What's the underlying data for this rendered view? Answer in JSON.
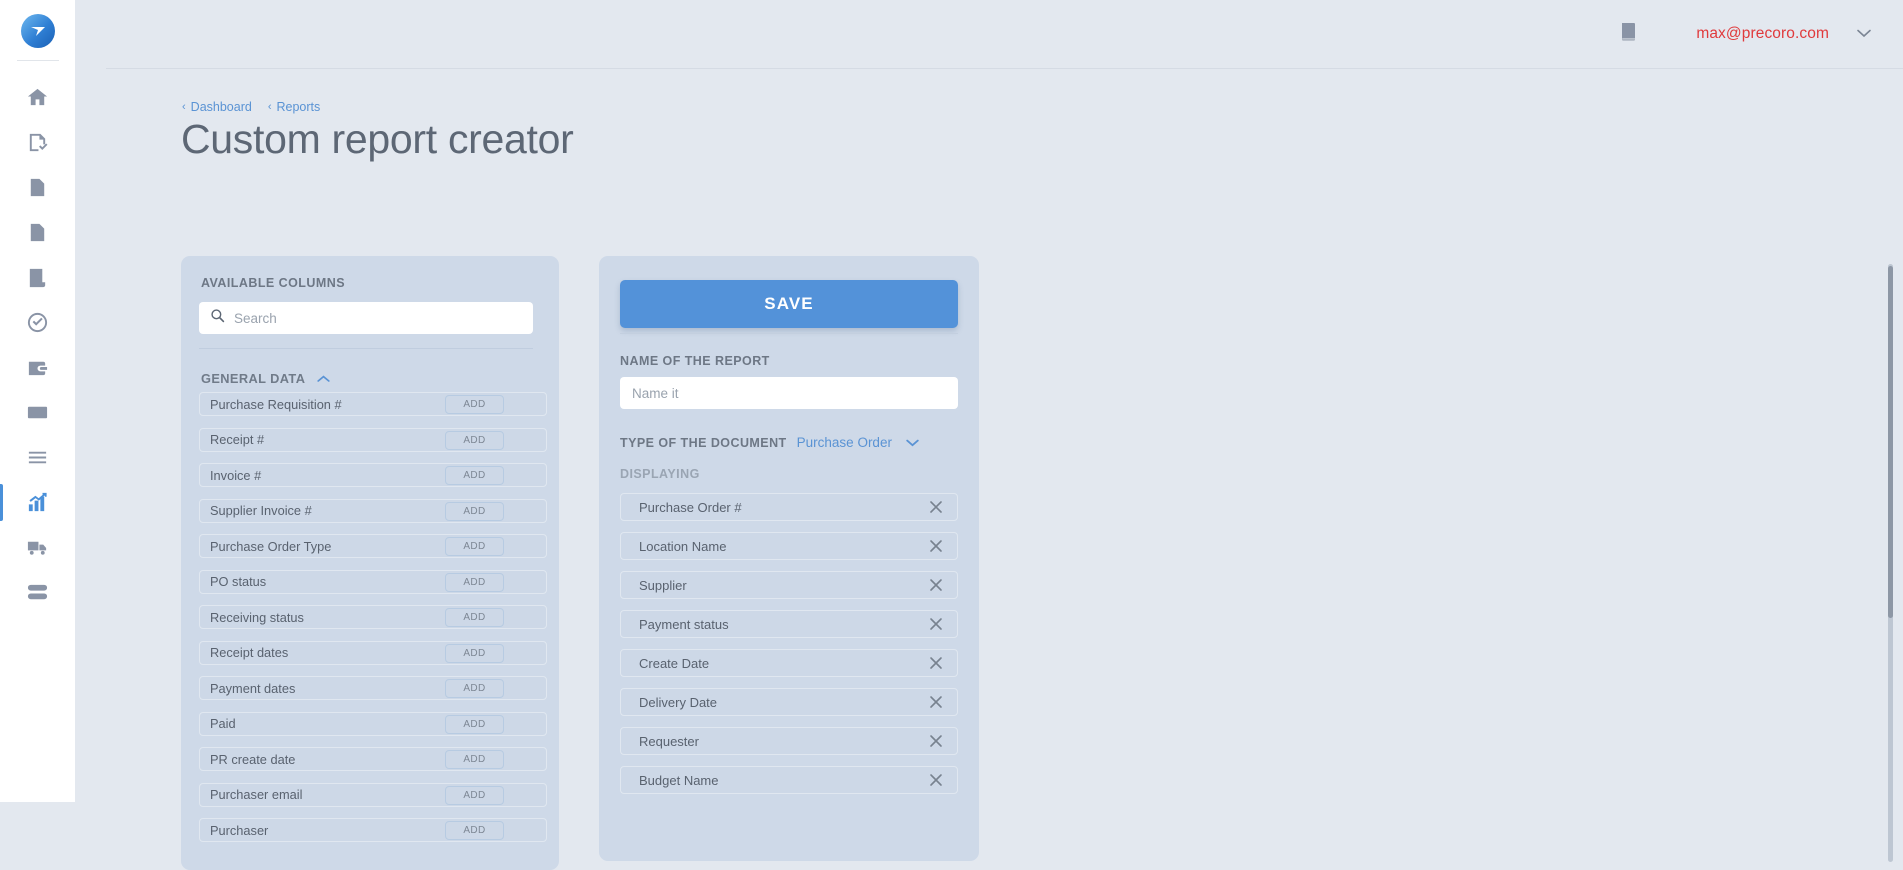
{
  "app": {
    "logo_name": "precoro-logo"
  },
  "nav": {
    "items": [
      {
        "name": "home",
        "icon": "home-icon",
        "active": false
      },
      {
        "name": "purchase-requisitions",
        "icon": "document-check-icon",
        "active": false
      },
      {
        "name": "purchase-orders",
        "icon": "document-lines-icon",
        "active": false
      },
      {
        "name": "invoices",
        "icon": "document-lines-alt-icon",
        "active": false
      },
      {
        "name": "receipts",
        "icon": "receipt-icon",
        "active": false
      },
      {
        "name": "approvals",
        "icon": "check-circle-icon",
        "active": false
      },
      {
        "name": "expenses",
        "icon": "wallet-icon",
        "active": false
      },
      {
        "name": "payments",
        "icon": "credit-card-icon",
        "active": false
      },
      {
        "name": "catalog",
        "icon": "list-lines-icon",
        "active": false
      },
      {
        "name": "reports",
        "icon": "bar-chart-icon",
        "active": true
      },
      {
        "name": "suppliers",
        "icon": "truck-icon",
        "active": false
      },
      {
        "name": "inventory",
        "icon": "server-icon",
        "active": false
      }
    ]
  },
  "header": {
    "book_icon": "book-icon",
    "user_email": "max@precoro.com",
    "chevron_icon": "chevron-down-icon"
  },
  "breadcrumb": {
    "items": [
      {
        "label": "Dashboard",
        "chevron": "‹"
      },
      {
        "label": "Reports",
        "chevron": "‹"
      }
    ]
  },
  "page": {
    "title": "Custom report creator"
  },
  "available_columns": {
    "heading": "AVAILABLE COLUMNS",
    "search": {
      "placeholder": "Search",
      "value": "",
      "icon": "search-icon"
    },
    "group": {
      "title": "GENERAL DATA",
      "collapse_icon": "chevron-up-icon",
      "expanded": true
    },
    "add_label": "ADD",
    "items": [
      {
        "label": "Purchase Requisition #"
      },
      {
        "label": "Receipt #"
      },
      {
        "label": "Invoice #"
      },
      {
        "label": "Supplier Invoice #"
      },
      {
        "label": "Purchase Order Type"
      },
      {
        "label": "PO status"
      },
      {
        "label": "Receiving status"
      },
      {
        "label": "Receipt dates"
      },
      {
        "label": "Payment dates"
      },
      {
        "label": "Paid"
      },
      {
        "label": "PR create date"
      },
      {
        "label": "Purchaser email"
      },
      {
        "label": "Purchaser"
      }
    ]
  },
  "report_form": {
    "save_label": "SAVE",
    "name_label": "NAME OF THE REPORT",
    "name_placeholder": "Name it",
    "name_value": "",
    "doctype_label": "TYPE OF THE DOCUMENT",
    "doctype_value": "Purchase Order",
    "doctype_chevron": "chevron-down-icon",
    "displaying_label": "DISPLAYING",
    "remove_icon": "close-icon",
    "displaying_items": [
      {
        "label": "Purchase Order #"
      },
      {
        "label": "Location Name"
      },
      {
        "label": "Supplier"
      },
      {
        "label": "Payment status"
      },
      {
        "label": "Create Date"
      },
      {
        "label": "Delivery Date"
      },
      {
        "label": "Requester"
      },
      {
        "label": "Budget Name"
      }
    ]
  },
  "colors": {
    "accent_blue": "#5392d9",
    "link_blue": "#5a93d4",
    "email_red": "#e03a3c",
    "page_bg": "#e3e8ef",
    "panel_bg": "#ced9e8"
  }
}
